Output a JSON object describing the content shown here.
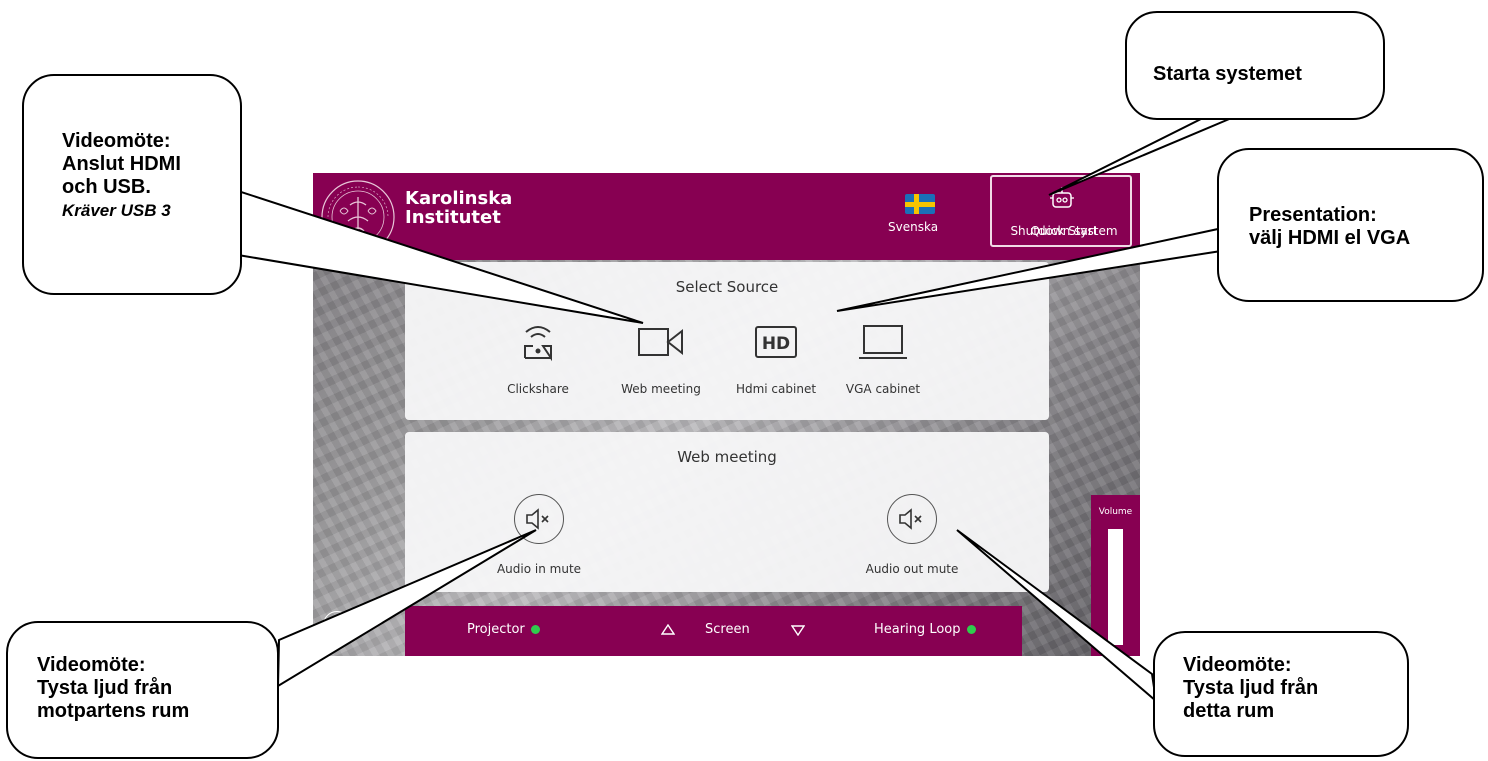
{
  "panel": {
    "brand": {
      "line1": "Karolinska",
      "line2": "Institutet",
      "seal_text": "KAROLINSKA INSTITUTET"
    },
    "language": {
      "label": "Svenska",
      "flag_icon": "sweden-flag-icon"
    },
    "quick_button": {
      "icon": "power-robot-icon",
      "label_a": "Shutdown system",
      "label_b": "Quick Start"
    },
    "select_source": {
      "title": "Select Source",
      "sources": [
        {
          "label": "Clickshare",
          "icon": "wireless-share-icon"
        },
        {
          "label": "Web meeting",
          "icon": "video-camera-icon"
        },
        {
          "label": "Hdmi cabinet",
          "icon": "hd-icon",
          "icon_text": "HD"
        },
        {
          "label": "VGA cabinet",
          "icon": "laptop-icon"
        }
      ]
    },
    "web_meeting": {
      "title": "Web meeting",
      "audio_in": {
        "label": "Audio in mute",
        "icon": "speaker-mute-icon"
      },
      "audio_out": {
        "label": "Audio out mute",
        "icon": "speaker-mute-icon"
      }
    },
    "bottom_bar": {
      "projector": "Projector",
      "screen": "Screen",
      "hearing_loop": "Hearing Loop",
      "status_color": "#2fcc4d"
    },
    "volume": {
      "label": "Volume",
      "level": 0.0
    },
    "colors": {
      "brand": "#870052",
      "card": "#f6f6f7"
    }
  },
  "callouts": {
    "videomote_anslut": {
      "l1": "Videomöte:",
      "l2": "Anslut HDMI",
      "l3": "och USB.",
      "l4": "Kräver USB 3"
    },
    "starta": {
      "l1": "Starta systemet"
    },
    "presentation": {
      "l1": "Presentation:",
      "l2": "välj HDMI el VGA"
    },
    "tysta_motpart": {
      "l1": "Videomöte:",
      "l2": "Tysta ljud från",
      "l3": "motpartens rum"
    },
    "tysta_detta": {
      "l1": "Videomöte:",
      "l2": "Tysta ljud från",
      "l3": "detta rum"
    }
  }
}
